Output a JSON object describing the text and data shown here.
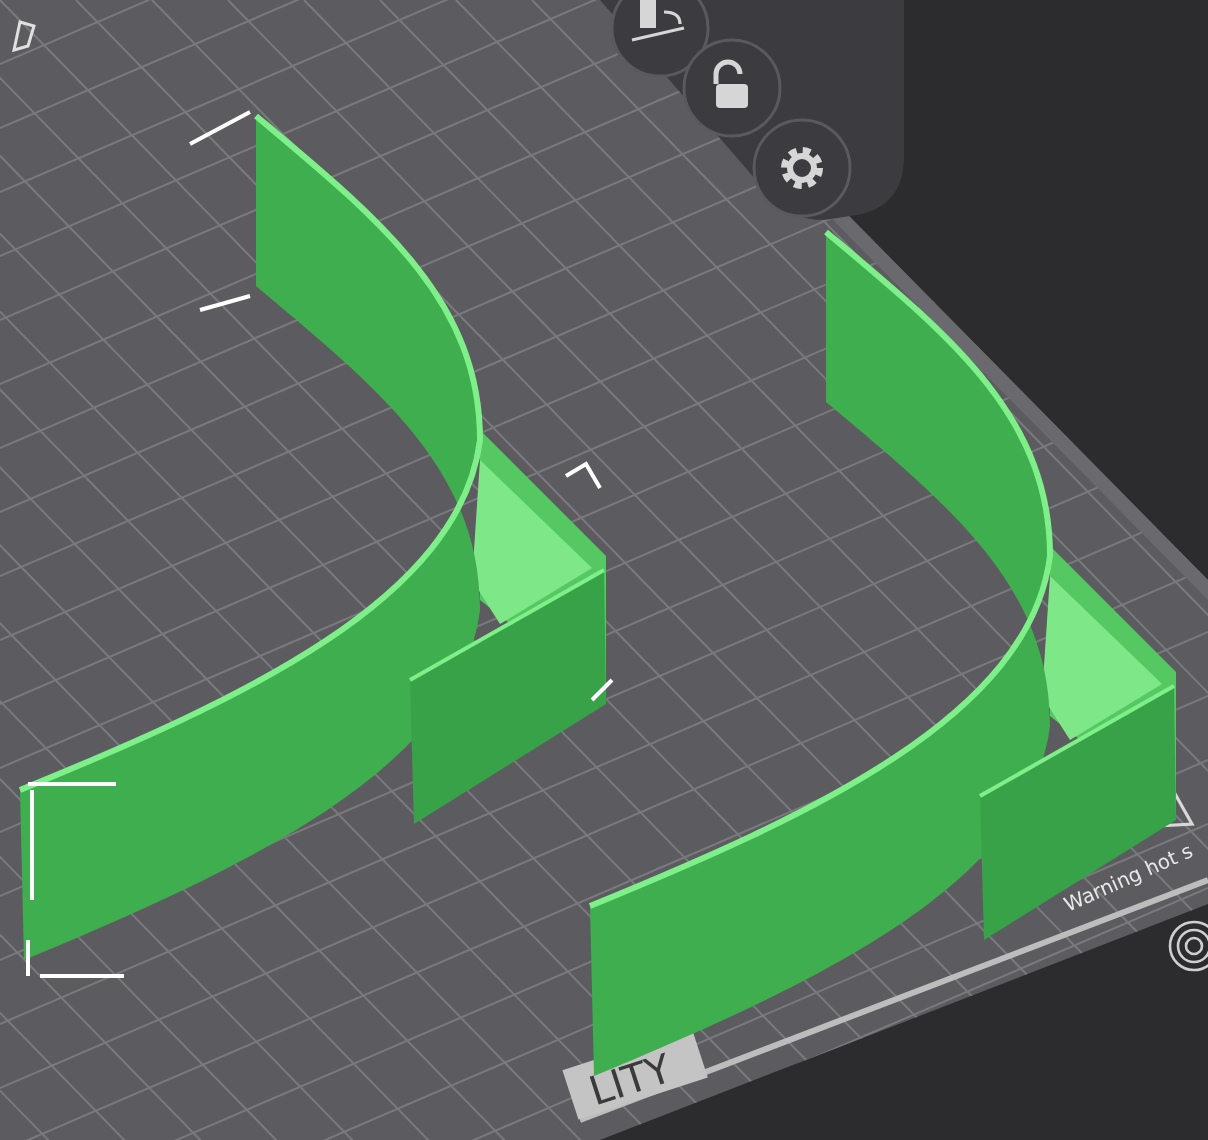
{
  "toolbar": {
    "buttons": [
      {
        "kind": "lay-flat"
      },
      {
        "kind": "lock"
      },
      {
        "kind": "settings"
      }
    ]
  },
  "objects": [
    {
      "selected": true
    },
    {
      "selected": false
    }
  ],
  "bed": {
    "labels": [
      {
        "kind": "warning",
        "text": "Warning hot s"
      },
      {
        "kind": "plate",
        "text": "LITY"
      }
    ]
  }
}
